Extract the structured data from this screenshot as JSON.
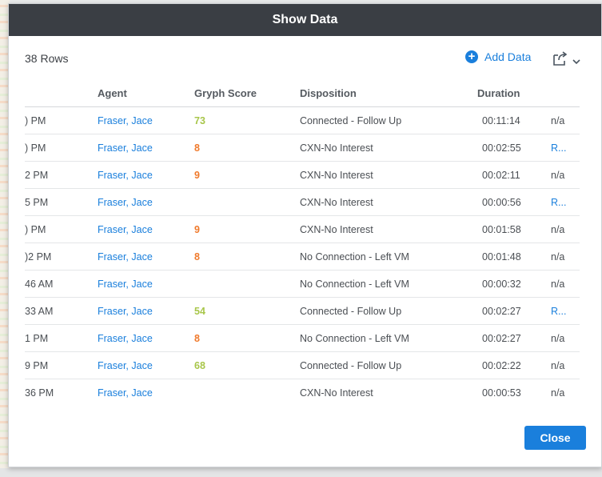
{
  "dialog": {
    "title": "Show Data",
    "rows_label": "38 Rows",
    "add_data_label": "Add Data",
    "close_label": "Close"
  },
  "colors": {
    "header_bg": "#3a3e44",
    "accent": "#1a7fdc",
    "score_high": "#a8c64a",
    "score_low": "#f07a2c"
  },
  "table": {
    "columns": [
      "Agent",
      "Gryph Score",
      "Disposition",
      "Duration"
    ],
    "rows": [
      {
        "time": ") PM",
        "agent": "Fraser, Jace",
        "score": "73",
        "score_level": "high",
        "disposition": "Connected - Follow Up",
        "duration": "00:11:14",
        "last": "n/a",
        "last_is_link": false
      },
      {
        "time": ") PM",
        "agent": "Fraser, Jace",
        "score": "8",
        "score_level": "low",
        "disposition": "CXN-No Interest",
        "duration": "00:02:55",
        "last": "R...",
        "last_is_link": true
      },
      {
        "time": "2 PM",
        "agent": "Fraser, Jace",
        "score": "9",
        "score_level": "low",
        "disposition": "CXN-No Interest",
        "duration": "00:02:11",
        "last": "n/a",
        "last_is_link": false
      },
      {
        "time": "5 PM",
        "agent": "Fraser, Jace",
        "score": "",
        "score_level": "",
        "disposition": "CXN-No Interest",
        "duration": "00:00:56",
        "last": "R...",
        "last_is_link": true
      },
      {
        "time": ") PM",
        "agent": "Fraser, Jace",
        "score": "9",
        "score_level": "low",
        "disposition": "CXN-No Interest",
        "duration": "00:01:58",
        "last": "n/a",
        "last_is_link": false
      },
      {
        "time": ")2 PM",
        "agent": "Fraser, Jace",
        "score": "8",
        "score_level": "low",
        "disposition": "No Connection - Left VM",
        "duration": "00:01:48",
        "last": "n/a",
        "last_is_link": false
      },
      {
        "time": "46 AM",
        "agent": "Fraser, Jace",
        "score": "",
        "score_level": "",
        "disposition": "No Connection - Left VM",
        "duration": "00:00:32",
        "last": "n/a",
        "last_is_link": false
      },
      {
        "time": "33 AM",
        "agent": "Fraser, Jace",
        "score": "54",
        "score_level": "high",
        "disposition": "Connected - Follow Up",
        "duration": "00:02:27",
        "last": "R...",
        "last_is_link": true
      },
      {
        "time": "1 PM",
        "agent": "Fraser, Jace",
        "score": "8",
        "score_level": "low",
        "disposition": "No Connection - Left VM",
        "duration": "00:02:27",
        "last": "n/a",
        "last_is_link": false
      },
      {
        "time": "9 PM",
        "agent": "Fraser, Jace",
        "score": "68",
        "score_level": "high",
        "disposition": "Connected - Follow Up",
        "duration": "00:02:22",
        "last": "n/a",
        "last_is_link": false
      },
      {
        "time": "36 PM",
        "agent": "Fraser, Jace",
        "score": "",
        "score_level": "",
        "disposition": "CXN-No Interest",
        "duration": "00:00:53",
        "last": "n/a",
        "last_is_link": false
      }
    ]
  }
}
